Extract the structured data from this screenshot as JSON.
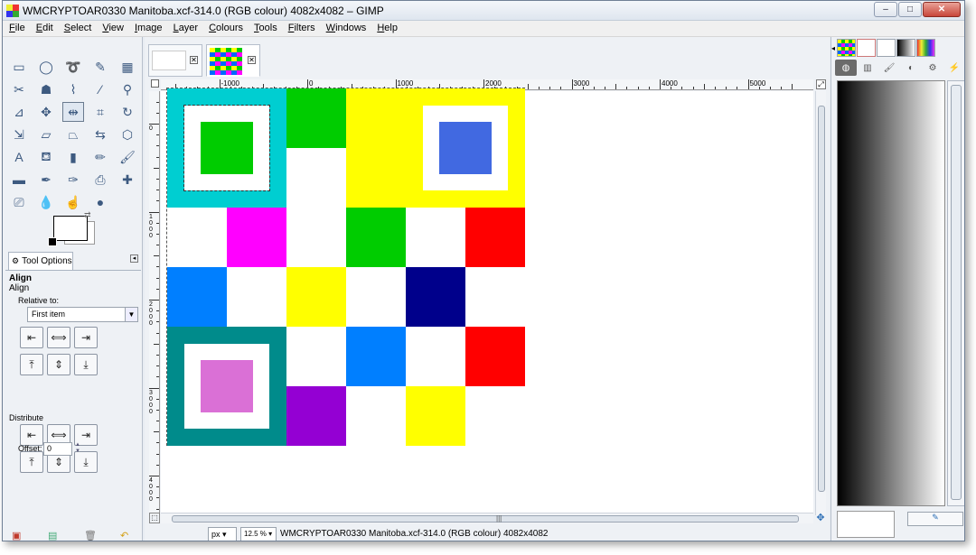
{
  "window": {
    "title": "WMCRYPTOAR0330 Manitoba.xcf-314.0 (RGB colour) 4082x4082 – GIMP",
    "controls": {
      "minimize": "–",
      "maximize": "□",
      "close": "✕"
    }
  },
  "menubar": [
    {
      "u": "F",
      "rest": "ile"
    },
    {
      "u": "E",
      "rest": "dit"
    },
    {
      "u": "S",
      "rest": "elect"
    },
    {
      "u": "V",
      "rest": "iew"
    },
    {
      "u": "I",
      "rest": "mage"
    },
    {
      "u": "L",
      "rest": "ayer"
    },
    {
      "u": "C",
      "rest": "olours"
    },
    {
      "u": "T",
      "rest": "ools"
    },
    {
      "u": "F",
      "rest": "ilters"
    },
    {
      "u": "W",
      "rest": "indows"
    },
    {
      "u": "H",
      "rest": "elp"
    }
  ],
  "toolbox": {
    "tools": [
      {
        "name": "rect-select-icon",
        "glyph": "▭"
      },
      {
        "name": "ellipse-select-icon",
        "glyph": "◯"
      },
      {
        "name": "lasso-icon",
        "glyph": "➰"
      },
      {
        "name": "fuzzy-select-icon",
        "glyph": "✎"
      },
      {
        "name": "color-select-icon",
        "glyph": "▦"
      },
      {
        "name": "scissors-icon",
        "glyph": "✂"
      },
      {
        "name": "foreground-select-icon",
        "glyph": "☗"
      },
      {
        "name": "paths-icon",
        "glyph": "⌇"
      },
      {
        "name": "color-picker-icon",
        "glyph": "⁄"
      },
      {
        "name": "zoom-icon",
        "glyph": "⚲"
      },
      {
        "name": "measure-icon",
        "glyph": "⊿"
      },
      {
        "name": "move-icon",
        "glyph": "✥"
      },
      {
        "name": "align-icon",
        "glyph": "⇹"
      },
      {
        "name": "crop-icon",
        "glyph": "⌗"
      },
      {
        "name": "rotate-icon",
        "glyph": "↻"
      },
      {
        "name": "scale-icon",
        "glyph": "⇲"
      },
      {
        "name": "shear-icon",
        "glyph": "▱"
      },
      {
        "name": "perspective-icon",
        "glyph": "⏢"
      },
      {
        "name": "flip-icon",
        "glyph": "⇆"
      },
      {
        "name": "cage-icon",
        "glyph": "⬡"
      },
      {
        "name": "text-icon",
        "glyph": "A"
      },
      {
        "name": "bucket-fill-icon",
        "glyph": "⛾"
      },
      {
        "name": "blend-icon",
        "glyph": "▮"
      },
      {
        "name": "pencil-icon",
        "glyph": "✏"
      },
      {
        "name": "paintbrush-icon",
        "glyph": "🖌"
      },
      {
        "name": "eraser-icon",
        "glyph": "▬"
      },
      {
        "name": "airbrush-icon",
        "glyph": "✒"
      },
      {
        "name": "ink-icon",
        "glyph": "✑"
      },
      {
        "name": "clone-icon",
        "glyph": "⎙"
      },
      {
        "name": "heal-icon",
        "glyph": "✚"
      },
      {
        "name": "perspective-clone-icon",
        "glyph": "⎚"
      },
      {
        "name": "blur-icon",
        "glyph": "💧"
      },
      {
        "name": "smudge-icon",
        "glyph": "☝"
      },
      {
        "name": "dodge-burn-icon",
        "glyph": "●"
      }
    ],
    "active_tool_index": 12
  },
  "tool_options": {
    "tab_label": "Tool Options",
    "title": "Align",
    "subtitle": "Align",
    "relative_to_label": "Relative to:",
    "relative_to_value": "First item",
    "distribute_label": "Distribute",
    "offset_label": "Offset:",
    "offset_value": "0",
    "align_buttons": [
      "⇤",
      "⟺",
      "⇥",
      "⤒",
      "⇕",
      "⤓"
    ],
    "distribute_buttons": [
      "⇤",
      "⟺",
      "⇥",
      "⤒",
      "⇕",
      "⤓"
    ]
  },
  "image_tabs": [
    {
      "close": "✕"
    },
    {
      "close": "✕"
    }
  ],
  "hruler_labels": [
    {
      "text": "-1000",
      "value": -1000
    },
    {
      "text": "0",
      "value": 0
    },
    {
      "text": "1000",
      "value": 1000
    },
    {
      "text": "2000",
      "value": 2000
    },
    {
      "text": "3000",
      "value": 3000
    },
    {
      "text": "4000",
      "value": 4000
    },
    {
      "text": "5000",
      "value": 5000
    }
  ],
  "vruler_labels": [
    {
      "text": "0",
      "value": 0
    },
    {
      "text": "1000",
      "value": 1000
    },
    {
      "text": "2000",
      "value": 2000
    },
    {
      "text": "3000",
      "value": 3000
    },
    {
      "text": "4000",
      "value": 4000
    }
  ],
  "image_grid": [
    [
      "#00CED1",
      "#FFFFFF",
      "#00CC00",
      "#FFFF00",
      "#FFFF00",
      "#FFFF00"
    ],
    [
      "#00CED1",
      "#008000",
      "#FFFFFF",
      "#FFFF00",
      "#FFFF00",
      "#FFFF00"
    ],
    [
      "#FFFFFF",
      "#FF00FF",
      "#FFFFFF",
      "#00CC00",
      "#FFFFFF",
      "#FF0000"
    ],
    [
      "#007FFF",
      "#FFFFFF",
      "#FFFF00",
      "#FFFFFF",
      "#00008B",
      "#FFFFFF"
    ],
    [
      "#008B8B",
      "#008B8B",
      "#FFFFFF",
      "#007FFF",
      "#FFFFFF",
      "#FF0000"
    ],
    [
      "#008B8B",
      "#008B8B",
      "#9400D3",
      "#FFFFFF",
      "#FFFF00",
      "#FFFFFF"
    ]
  ],
  "image_squares": [
    {
      "outer": "#00CED1",
      "inner": "#FFFFFF",
      "center": "#00CC00",
      "dashed": true
    },
    {
      "outer": "#FFFF00",
      "inner": "#FFFFFF",
      "center": "#4169E1",
      "dashed": false
    },
    {
      "outer": "#008B8B",
      "inner": "#FFFFFF",
      "center": "#DA70D6",
      "dashed": false
    }
  ],
  "statusbar": {
    "unit": "px",
    "zoom": "12.5 %",
    "text": "WMCRYPTOAR0330 Manitoba.xcf-314.0 (RGB colour) 4082x4082"
  },
  "right_dock": {
    "tabs": [
      "checker",
      "gradient-fg",
      "brush-cross",
      "gradient",
      "palette"
    ],
    "subtabs": [
      "◍",
      "▥",
      "🖌",
      "◐",
      "⚙",
      "⚡"
    ],
    "button_glyph": "✎"
  }
}
